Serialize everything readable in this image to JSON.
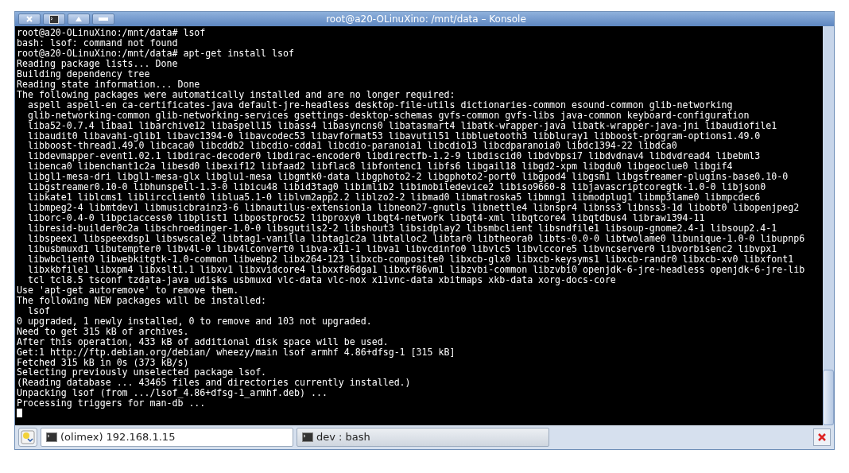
{
  "window": {
    "title": "root@a20-OLinuXino: /mnt/data – Konsole"
  },
  "terminal": {
    "lines": [
      "root@a20-OLinuXino:/mnt/data# lsof",
      "bash: lsof: command not found",
      "root@a20-OLinuXino:/mnt/data# apt-get install lsof",
      "Reading package lists... Done",
      "Building dependency tree",
      "Reading state information... Done",
      "The following packages were automatically installed and are no longer required:",
      "  aspell aspell-en ca-certificates-java default-jre-headless desktop-file-utils dictionaries-common esound-common glib-networking",
      "  glib-networking-common glib-networking-services gsettings-desktop-schemas gvfs-common gvfs-libs java-common keyboard-configuration",
      "  liba52-0.7.4 libaa1 libarchive12 libaspell15 libass4 libasyncns0 libatasmart4 libatk-wrapper-java libatk-wrapper-java-jni libaudiofile1",
      "  libaudit0 libavahi-glib1 libavc1394-0 libavcodec53 libavformat53 libavutil51 libbluetooth3 libbluray1 libboost-program-options1.49.0",
      "  libboost-thread1.49.0 libcaca0 libcddb2 libcdio-cdda1 libcdio-paranoia1 libcdio13 libcdparanoia0 libdc1394-22 libdca0",
      "  libdevmapper-event1.02.1 libdirac-decoder0 libdirac-encoder0 libdirectfb-1.2-9 libdiscid0 libdvbpsi7 libdvdnav4 libdvdread4 libebml3",
      "  libenca0 libenchant1c2a libesd0 libexif12 libfaad2 libflac8 libfontenc1 libfs6 libgail18 libgd2-xpm libgdu0 libgeoclue0 libgif4",
      "  libgl1-mesa-dri libgl1-mesa-glx libglu1-mesa libgmtk0-data libgphoto2-2 libgphoto2-port0 libgpod4 libgsm1 libgstreamer-plugins-base0.10-0",
      "  libgstreamer0.10-0 libhunspell-1.3-0 libicu48 libid3tag0 libimlib2 libimobiledevice2 libiso9660-8 libjavascriptcoregtk-1.0-0 libjson0",
      "  libkate1 liblcms1 liblircclient0 liblua5.1-0 liblvm2app2.2 liblzo2-2 libmad0 libmatroska5 libmng1 libmodplug1 libmp3lame0 libmpcdec6",
      "  libmpeg2-4 libmtdev1 libmusicbrainz3-6 libnautilus-extension1a libneon27-gnutls libnettle4 libnspr4 libnss3 libnss3-1d libobt0 libopenjpeg2",
      "  liborc-0.4-0 libpciaccess0 libplist1 libpostproc52 libproxy0 libqt4-network libqt4-xml libqtcore4 libqtdbus4 libraw1394-11",
      "  libresid-builder0c2a libschroedinger-1.0-0 libsgutils2-2 libshout3 libsidplay2 libsmbclient libsndfile1 libsoup-gnome2.4-1 libsoup2.4-1",
      "  libspeex1 libspeexdsp1 libswscale2 libtag1-vanilla libtag1c2a libtalloc2 libtar0 libtheora0 libts-0.0-0 libtwolame0 libunique-1.0-0 libupnp6",
      "  libusbmuxd1 libutempter0 libv4l-0 libv4lconvert0 libva-x11-1 libva1 libvcdinfo0 libvlc5 libvlccore5 libvncserver0 libvorbisenc2 libvpx1",
      "  libwbclient0 libwebkitgtk-1.0-common libwebp2 libx264-123 libxcb-composite0 libxcb-glx0 libxcb-keysyms1 libxcb-randr0 libxcb-xv0 libxfont1",
      "  libxkbfile1 libxpm4 libxslt1.1 libxv1 libxvidcore4 libxxf86dga1 libxxf86vm1 libzvbi-common libzvbi0 openjdk-6-jre-headless openjdk-6-jre-lib",
      "  tcl tcl8.5 tsconf tzdata-java udisks usbmuxd vlc-data vlc-nox x11vnc-data xbitmaps xkb-data xorg-docs-core",
      "Use 'apt-get autoremove' to remove them.",
      "The following NEW packages will be installed:",
      "  lsof",
      "0 upgraded, 1 newly installed, 0 to remove and 103 not upgraded.",
      "Need to get 315 kB of archives.",
      "After this operation, 433 kB of additional disk space will be used.",
      "Get:1 http://ftp.debian.org/debian/ wheezy/main lsof armhf 4.86+dfsg-1 [315 kB]",
      "Fetched 315 kB in 0s (373 kB/s)",
      "Selecting previously unselected package lsof.",
      "(Reading database ... 43465 files and directories currently installed.)",
      "Unpacking lsof (from .../lsof_4.86+dfsg-1_armhf.deb) ...",
      "Processing triggers for man-db ..."
    ]
  },
  "tabs": [
    {
      "label": "(olimex) 192.168.1.15",
      "selected": true
    },
    {
      "label": "dev : bash",
      "selected": false
    }
  ]
}
